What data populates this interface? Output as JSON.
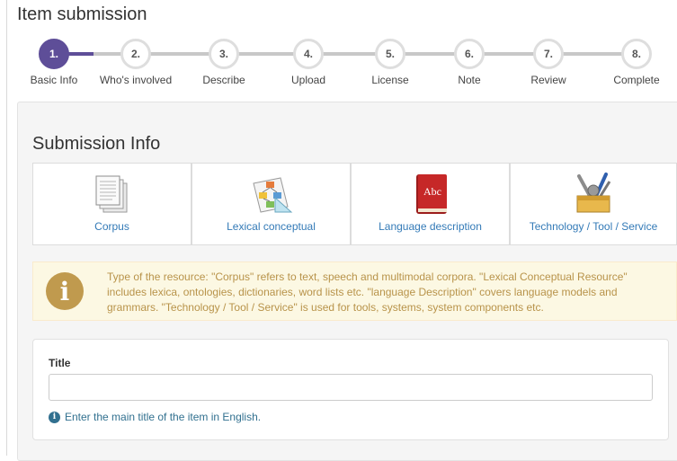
{
  "page": {
    "title": "Item submission"
  },
  "stepper": {
    "steps": [
      {
        "number": "1.",
        "label": "Basic Info"
      },
      {
        "number": "2.",
        "label": "Who's involved"
      },
      {
        "number": "3.",
        "label": "Describe"
      },
      {
        "number": "4.",
        "label": "Upload"
      },
      {
        "number": "5.",
        "label": "License"
      },
      {
        "number": "6.",
        "label": "Note"
      },
      {
        "number": "7.",
        "label": "Review"
      },
      {
        "number": "8.",
        "label": "Complete"
      }
    ],
    "active_step": 1,
    "accent_color": "#5e4e98"
  },
  "submission": {
    "title": "Submission Info",
    "types": [
      {
        "label": "Corpus",
        "icon": "documents-icon"
      },
      {
        "label": "Lexical conceptual",
        "icon": "diagram-icon"
      },
      {
        "label": "Language description",
        "icon": "book-icon"
      },
      {
        "label": "Technology / Tool / Service",
        "icon": "toolbox-icon"
      }
    ]
  },
  "alert": {
    "text": "Type of the resource: \"Corpus\" refers to text, speech and multimodal corpora. \"Lexical Conceptual Resource\" includes lexica, ontologies, dictionaries, word lists etc. \"language Description\" covers language models and grammars. \"Technology / Tool / Service\" is used for tools, systems, system components etc.",
    "icon": "info-icon",
    "color": "#c09a4e"
  },
  "form": {
    "title_label": "Title",
    "title_value": "",
    "title_placeholder": "",
    "title_help": "Enter the main title of the item in English.",
    "book_cover_text": "Abc"
  }
}
